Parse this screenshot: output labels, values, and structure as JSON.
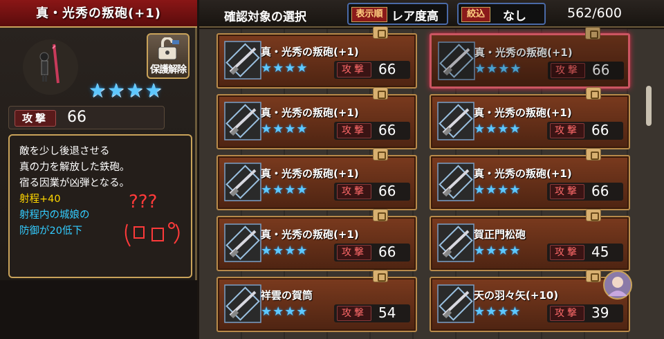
{
  "left_panel": {
    "title": "真・光秀の叛砲(+1)",
    "unlock_label": "保護解除",
    "stars": "★★★★",
    "attack_label": "攻撃",
    "attack_value": "66",
    "description": {
      "line1": "敵を少し後退させる",
      "line2": "真の力を解放した鉄砲。",
      "line3": "宿る因業が凶弾となる。",
      "line4": "射程+40",
      "line5": "射程内の城娘の",
      "line6": "防御が20低下"
    },
    "scribble_text": "???"
  },
  "header": {
    "title": "確認対象の選択",
    "sort_key": "表示順",
    "sort_value": "レア度高",
    "filter_key": "絞込",
    "filter_value": "なし",
    "count": "562/600"
  },
  "cards": [
    {
      "name": "真・光秀の叛砲(+1)",
      "stars": "★★★★",
      "atk_label": "攻撃",
      "atk": "66",
      "selected": false
    },
    {
      "name": "真・光秀の叛砲(+1)",
      "stars": "★★★★",
      "atk_label": "攻撃",
      "atk": "66",
      "selected": true
    },
    {
      "name": "真・光秀の叛砲(+1)",
      "stars": "★★★★",
      "atk_label": "攻撃",
      "atk": "66",
      "selected": false
    },
    {
      "name": "真・光秀の叛砲(+1)",
      "stars": "★★★★",
      "atk_label": "攻撃",
      "atk": "66",
      "selected": false
    },
    {
      "name": "真・光秀の叛砲(+1)",
      "stars": "★★★★",
      "atk_label": "攻撃",
      "atk": "66",
      "selected": false
    },
    {
      "name": "真・光秀の叛砲(+1)",
      "stars": "★★★★",
      "atk_label": "攻撃",
      "atk": "66",
      "selected": false
    },
    {
      "name": "真・光秀の叛砲(+1)",
      "stars": "★★★★",
      "atk_label": "攻撃",
      "atk": "66",
      "selected": false
    },
    {
      "name": "賀正門松砲",
      "stars": "★★★★",
      "atk_label": "攻撃",
      "atk": "45",
      "selected": false
    },
    {
      "name": "祥雲の賀筒",
      "stars": "★★★★",
      "atk_label": "攻撃",
      "atk": "54",
      "selected": false
    },
    {
      "name": "天の羽々矢(+10)",
      "stars": "★★★★",
      "atk_label": "攻撃",
      "atk": "39",
      "selected": false
    }
  ],
  "colors": {
    "star": "#5ec8ff",
    "title_bar": "#8a1616",
    "gold_border": "#c9a35a",
    "selected_border": "#ff6a7a"
  }
}
